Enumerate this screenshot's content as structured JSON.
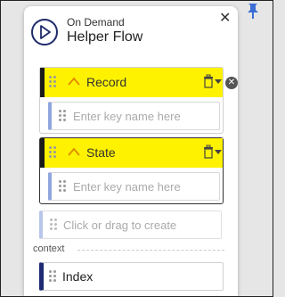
{
  "panel": {
    "subtitle": "On Demand",
    "title": "Helper Flow",
    "close_glyph": "✕"
  },
  "blocks": [
    {
      "label": "Record",
      "key_placeholder": "Enter key name here"
    },
    {
      "label": "State",
      "key_placeholder": "Enter key name here"
    }
  ],
  "remove_glyph": "✕",
  "create_slot": "Click or drag to create",
  "context": {
    "label": "context",
    "items": [
      {
        "label": "Index"
      }
    ]
  },
  "icons": {
    "pin": "pin-icon",
    "play": "play-circle-icon",
    "close": "close-icon",
    "grip": "drag-handle-icon",
    "collapse": "chevron-up-icon",
    "delete": "trash-icon",
    "dropdown": "caret-down-icon",
    "remove": "remove-circle-icon"
  },
  "colors": {
    "block_header": "#fff200",
    "accent_dark": "#1e2b73",
    "key_border": "#8fa6dd",
    "pin": "#3b6fd6"
  }
}
